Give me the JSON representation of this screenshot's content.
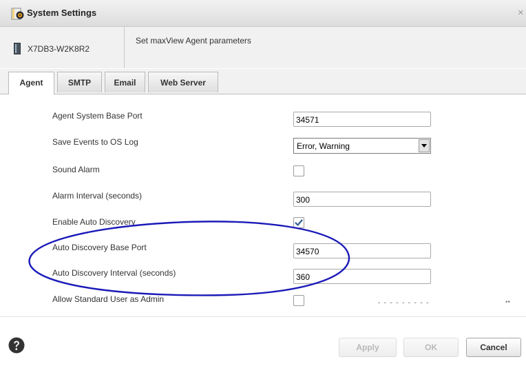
{
  "window": {
    "title": "System Settings",
    "close_glyph": "×"
  },
  "header": {
    "server_name": "X7DB3-W2K8R2",
    "description": "Set maxView Agent parameters"
  },
  "tabs": [
    {
      "label": "Agent",
      "active": true
    },
    {
      "label": "SMTP",
      "active": false
    },
    {
      "label": "Email",
      "active": false
    },
    {
      "label": "Web Server",
      "active": false
    }
  ],
  "form": {
    "base_port": {
      "label": "Agent System Base Port",
      "value": "34571"
    },
    "os_log": {
      "label": "Save Events to OS Log",
      "value": "Error, Warning"
    },
    "sound_alarm": {
      "label": "Sound Alarm",
      "checked": false
    },
    "alarm_interval": {
      "label": "Alarm Interval (seconds)",
      "value": "300"
    },
    "auto_discovery": {
      "label": "Enable Auto Discovery",
      "checked": true
    },
    "discovery_port": {
      "label": "Auto Discovery Base Port",
      "value": "34570"
    },
    "discovery_interval": {
      "label": "Auto Discovery Interval (seconds)",
      "value": "360"
    },
    "standard_user_admin": {
      "label": "Allow Standard User as Admin",
      "checked": false
    }
  },
  "footer": {
    "apply_label": "Apply",
    "ok_label": "OK",
    "cancel_label": "Cancel"
  },
  "colors": {
    "annotation": "#1a1ab8",
    "help_icon": "#333333",
    "checkmark": "#2f5f8f"
  },
  "icons": [
    "gear-folder-icon",
    "server-icon",
    "help-icon",
    "checkmark-icon",
    "chevron-down-icon",
    "close-icon"
  ]
}
